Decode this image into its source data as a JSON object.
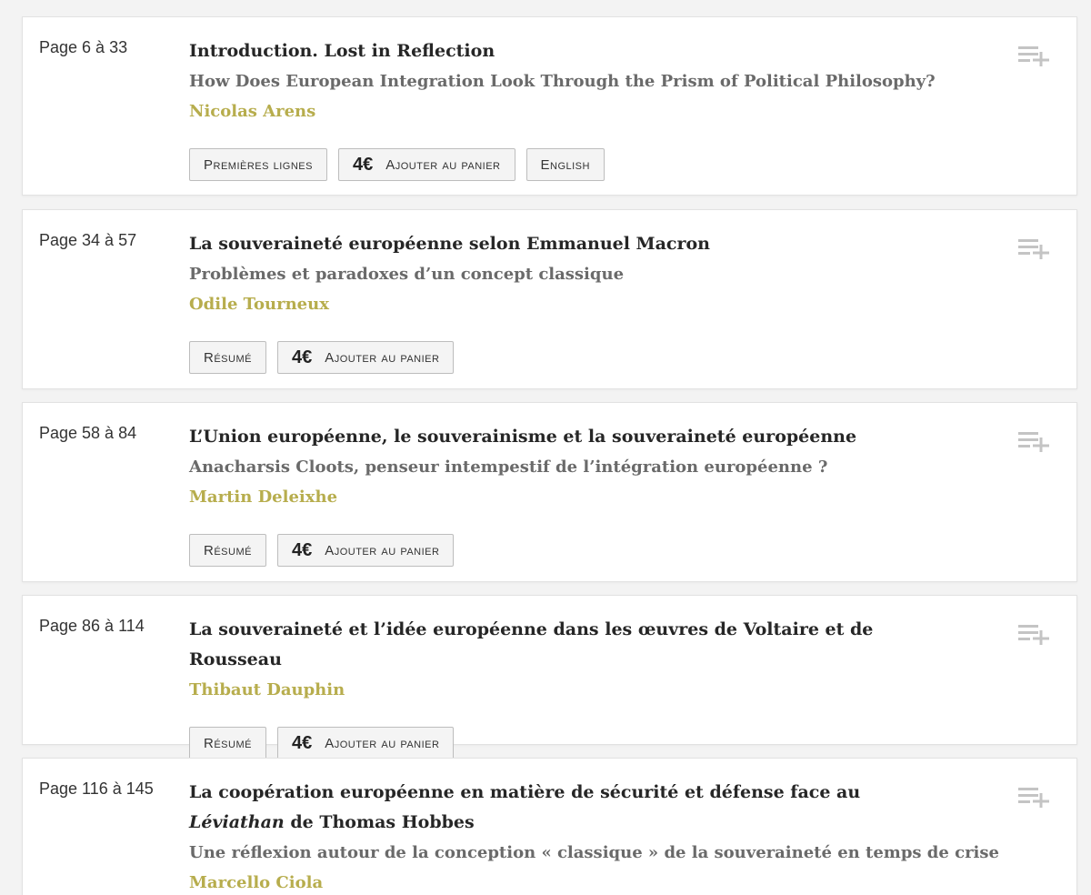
{
  "toc": {
    "items": [
      {
        "pages": "Page 6 à 33",
        "title": "Introduction. Lost in Reflection",
        "subtitle": "How Does European Integration Look Through the Prism of Political Philosophy?",
        "author": "Nicolas Arens",
        "buttons": {
          "first": "Premières lignes",
          "price": "4€",
          "cart": "Ajouter au panier",
          "extra": "English"
        }
      },
      {
        "pages": "Page 34 à 57",
        "title": "La souveraineté européenne selon Emmanuel Macron",
        "subtitle": "Problèmes et paradoxes d’un concept classique",
        "author": "Odile Tourneux",
        "buttons": {
          "first": "Résumé",
          "price": "4€",
          "cart": "Ajouter au panier"
        }
      },
      {
        "pages": "Page 58 à 84",
        "title": "L’Union européenne, le souverainisme et la souveraineté européenne",
        "subtitle": "Anacharsis Cloots, penseur intempestif de l’intégration européenne ?",
        "author": "Martin Deleixhe",
        "buttons": {
          "first": "Résumé",
          "price": "4€",
          "cart": "Ajouter au panier"
        }
      },
      {
        "pages": "Page 86 à 114",
        "title": "La souveraineté et l’idée européenne dans les œuvres de Voltaire et de Rousseau",
        "author": "Thibaut Dauphin",
        "buttons": {
          "first": "Résumé",
          "price": "4€",
          "cart": "Ajouter au panier"
        }
      },
      {
        "pages": "Page 116 à 145",
        "title_before": "La coopération européenne en matière de sécurité et défense face au ",
        "title_italic": "Léviathan",
        "title_after": " de Thomas Hobbes",
        "subtitle": "Une réflexion autour de la conception « classique » de la souveraineté en temps de crise",
        "author": "Marcello Ciola"
      }
    ]
  }
}
